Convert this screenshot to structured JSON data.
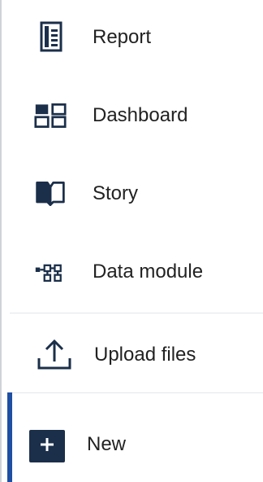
{
  "menu": {
    "items": [
      {
        "label": "Report",
        "icon": "report-icon"
      },
      {
        "label": "Dashboard",
        "icon": "dashboard-icon"
      },
      {
        "label": "Story",
        "icon": "story-book-icon"
      },
      {
        "label": "Data module",
        "icon": "data-module-icon"
      },
      {
        "label": "Upload files",
        "icon": "upload-icon"
      }
    ],
    "new_label": "New",
    "new_icon": "plus-icon"
  },
  "colors": {
    "icon": "#1b2f4a",
    "accent": "#1e4fa3",
    "divider": "#e3e6ea"
  }
}
